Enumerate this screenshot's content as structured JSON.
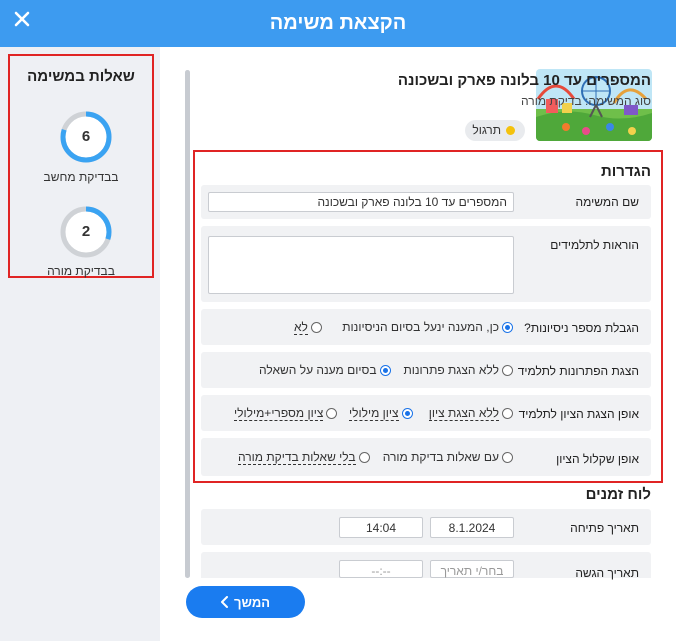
{
  "header": {
    "title": "הקצאת משימה"
  },
  "left_panel": {
    "title": "שאלות במשימה",
    "computer_count": "6",
    "computer_label": "בבדיקת מחשב",
    "computer_progress": 0.8,
    "teacher_count": "2",
    "teacher_label": "בבדיקת מורה",
    "teacher_progress": 0.3,
    "accent_color": "#3aa3f2"
  },
  "task": {
    "title": "המספרים עד 10 בלונה פארק ובשכונה",
    "type_line": "סוג המשימה: בדיקת מורה",
    "badge": "תרגול"
  },
  "settings": {
    "section_title": "הגדרות",
    "name_label": "שם המשימה",
    "name_value": "המספרים עד 10 בלונה פארק ובשכונה",
    "instructions_label": "הוראות לתלמידים",
    "attempts_label": "הגבלת מספר ניסיונות?",
    "attempts_yes": "כן, המענה ינעל בסיום הניסיונות",
    "attempts_no": "לא",
    "solutions_label": "הצגת הפתרונות לתלמיד",
    "solutions_none": "ללא הצגת פתרונות",
    "solutions_end": "בסיום מענה על השאלה",
    "grade_label": "אופן הצגת הציון לתלמיד",
    "grade_none": "ללא הצגת ציון",
    "grade_verbal": "ציון מילולי",
    "grade_both": "ציון מספרי+מילולי",
    "weight_label": "אופן שקלול הציון",
    "weight_with": "עם שאלות בדיקת מורה",
    "weight_without": "בלי שאלות בדיקת מורה"
  },
  "schedule": {
    "section_title": "לוח זמנים",
    "open_label": "תאריך פתיחה",
    "open_date": "8.1.2024",
    "open_time": "14:04",
    "submit_label": "תאריך הגשה",
    "submit_date_placeholder": "בחר/י תאריך",
    "submit_time_placeholder": "--:--"
  },
  "footer": {
    "continue_label": "המשך"
  },
  "colors": {
    "header": "#3d9bf0",
    "button": "#1a7cf0",
    "highlight_border": "#e02424"
  }
}
